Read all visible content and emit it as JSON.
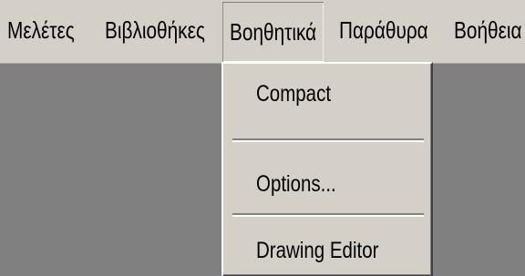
{
  "menubar": {
    "items": [
      {
        "label": "Μελέτες"
      },
      {
        "label": "Βιβλιοθήκες"
      },
      {
        "label": "Βοηθητικά"
      },
      {
        "label": "Παράθυρα"
      },
      {
        "label": "Βοήθεια"
      }
    ],
    "open_index": 2
  },
  "dropdown": {
    "items": [
      {
        "label": "Compact"
      },
      {
        "label": "Options..."
      },
      {
        "label": "Drawing Editor"
      }
    ]
  },
  "colors": {
    "menu_face": "#d4d0c8",
    "workspace": "#808080",
    "text": "#000000"
  }
}
